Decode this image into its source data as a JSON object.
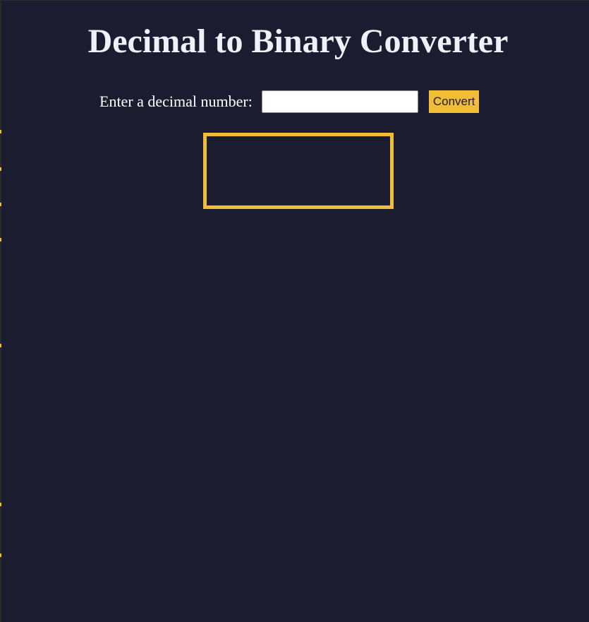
{
  "header": {
    "title": "Decimal to Binary Converter"
  },
  "form": {
    "label": "Enter a decimal number:",
    "input_value": "",
    "input_placeholder": "",
    "button_label": "Convert"
  },
  "result": {
    "text": ""
  },
  "colors": {
    "background": "#1c1c30",
    "accent": "#f0bd35",
    "text": "#ffffff"
  }
}
